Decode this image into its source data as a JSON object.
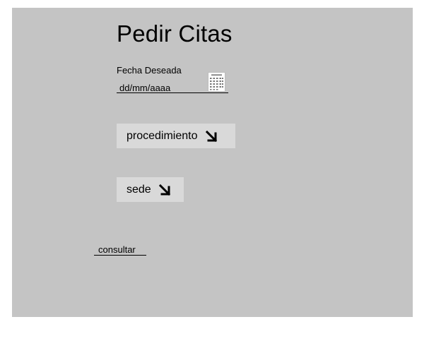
{
  "page": {
    "title": "Pedir Citas"
  },
  "form": {
    "date_label": "Fecha Deseada",
    "date_placeholder": "dd/mm/aaaa",
    "date_picker_icon": "calendar-icon",
    "procedure_label": "procedimiento",
    "site_label": "sede",
    "dropdown_icon": "arrow-down-right-icon",
    "consult_label": "consultar"
  },
  "colors": {
    "background": "#ffffff",
    "panel": "#c4c4c4",
    "button": "#d9d9d9",
    "text": "#000000"
  }
}
